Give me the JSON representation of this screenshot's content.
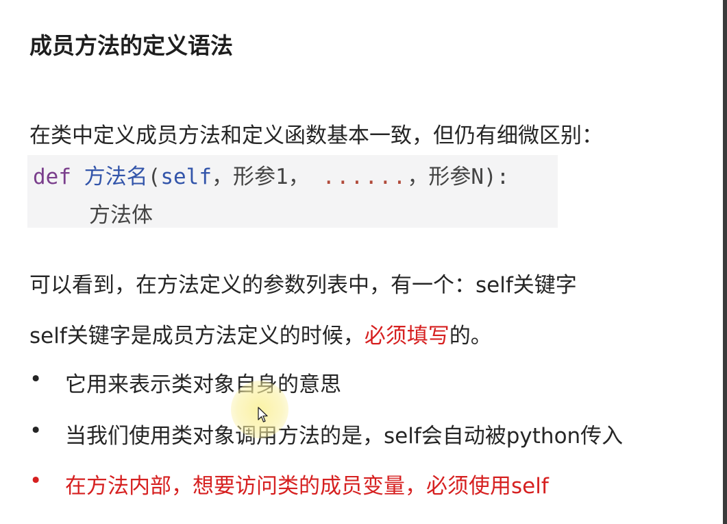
{
  "title": "成员方法的定义语法",
  "intro": "在类中定义成员方法和定义函数基本一致，但仍有细微区别：",
  "code": {
    "kw_def": "def",
    "method_name": "方法名",
    "open_paren": "(",
    "self_kw": "self",
    "sep1": "，",
    "param1": "形参1",
    "sep2": "，",
    "ellipsis": "......",
    "sep3": "，",
    "paramN": "形参N",
    "close": "):",
    "body": "方法体"
  },
  "paragraph_self_1": "可以看到，在方法定义的参数列表中，有一个：self关键字",
  "paragraph_self_2": {
    "before": "self关键字是成员方法定义的时候，",
    "emphasis": "必须填写",
    "after": "的。"
  },
  "bullets": [
    {
      "marker": "•",
      "text": "它用来表示类对象自身的意思"
    },
    {
      "marker": "•",
      "text": "当我们使用类对象调用方法的是，self会自动被python传入"
    },
    {
      "marker": "•",
      "text": "在方法内部，想要访问类的成员变量，必须使用self"
    }
  ],
  "colors": {
    "emphasis_red": "#d62020",
    "keyword_purple": "#7a3e8c",
    "identifier_blue": "#3355aa",
    "code_background": "#f4f4f5"
  }
}
